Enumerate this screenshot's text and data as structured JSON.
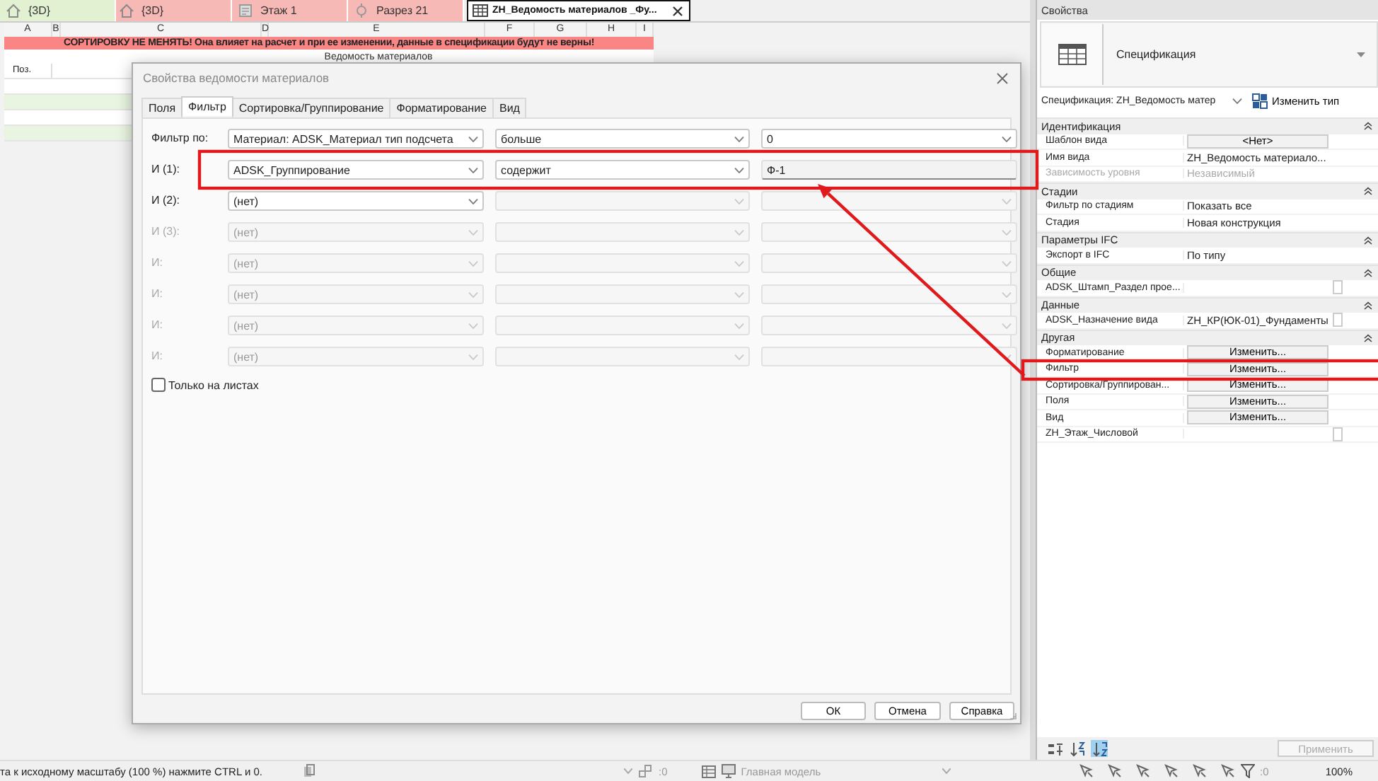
{
  "view_tabs": [
    {
      "label": "{3D}",
      "kind": "model",
      "color": "#e3f1d3",
      "selected": false
    },
    {
      "label": "{3D}",
      "kind": "model",
      "color": "#f7b9b6",
      "selected": false
    },
    {
      "label": "Этаж 1",
      "kind": "plan",
      "color": "#f7b9b6",
      "selected": false
    },
    {
      "label": "Разрез 21",
      "kind": "section",
      "color": "#f7b9b6",
      "selected": false
    },
    {
      "label": "ZH_Ведомость материалов _Фу...",
      "kind": "schedule",
      "color": "#ffffff",
      "selected": true
    }
  ],
  "schedule": {
    "columns": [
      "A",
      "B",
      "C",
      "D",
      "E",
      "F",
      "G",
      "H",
      "I"
    ],
    "banner": "СОРТИРОВКУ НЕ МЕНЯТЬ! Она влияет на расчет и при ее изменении, данные в спецификации будут не верны!",
    "title": "Ведомость материалов",
    "header_cell": "Поз."
  },
  "dialog": {
    "title": "Свойства ведомости материалов",
    "tabs": [
      {
        "label": "Поля",
        "selected": false
      },
      {
        "label": "Фильтр",
        "selected": true
      },
      {
        "label": "Сортировка/Группирование",
        "selected": false
      },
      {
        "label": "Форматирование",
        "selected": false
      },
      {
        "label": "Вид",
        "selected": false
      }
    ],
    "filter_rows": [
      {
        "label": "Фильтр по:",
        "highlighted": false,
        "disabled": false,
        "field": "Материал: ADSK_Материал тип подсчета",
        "condition": {
          "text": "больше",
          "disabled": false
        },
        "value": {
          "kind": "dropdown",
          "text": "0",
          "disabled": false
        }
      },
      {
        "label": "И (1):",
        "highlighted": true,
        "disabled": false,
        "field": "ADSK_Группирование",
        "condition": {
          "text": "содержит",
          "disabled": false
        },
        "value": {
          "kind": "text",
          "text": "Ф-1",
          "disabled": false
        }
      },
      {
        "label": "И (2):",
        "disabled": false,
        "field": "(нет)",
        "condition": {
          "disabled": true
        },
        "value": {
          "kind": "dropdown",
          "disabled": true
        }
      },
      {
        "label": "И (3):",
        "disabled": true,
        "field": "(нет)",
        "condition": {
          "disabled": true
        },
        "value": {
          "kind": "dropdown",
          "disabled": true
        }
      },
      {
        "label": "И:",
        "disabled": true,
        "field": "(нет)",
        "condition": {
          "disabled": true
        },
        "value": {
          "kind": "dropdown",
          "disabled": true
        }
      },
      {
        "label": "И:",
        "disabled": true,
        "field": "(нет)",
        "condition": {
          "disabled": true
        },
        "value": {
          "kind": "dropdown",
          "disabled": true
        }
      },
      {
        "label": "И:",
        "disabled": true,
        "field": "(нет)",
        "condition": {
          "disabled": true
        },
        "value": {
          "kind": "dropdown",
          "disabled": true
        }
      },
      {
        "label": "И:",
        "disabled": true,
        "field": "(нет)",
        "condition": {
          "disabled": true
        },
        "value": {
          "kind": "dropdown",
          "disabled": true
        }
      }
    ],
    "sheets_only": {
      "label": "Только на листах",
      "checked": false
    },
    "buttons": [
      "ОК",
      "Отмена",
      "Справка"
    ]
  },
  "properties": {
    "title": "Свойства",
    "type_name": "Спецификация",
    "instance_selector": "Спецификация: ZH_Ведомость матер",
    "edit_type": "Изменить тип",
    "groups": [
      {
        "name": "Идентификация",
        "expanded": true,
        "rows": [
          {
            "name": "Шаблон вида",
            "value": "<Нет>",
            "kind": "button",
            "disabled": false
          },
          {
            "name": "Имя вида",
            "value": "ZH_Ведомость материало...",
            "kind": "text",
            "disabled": false
          },
          {
            "name": "Зависимость уровня",
            "value": "Независимый",
            "kind": "text",
            "disabled": true
          }
        ]
      },
      {
        "name": "Стадии",
        "expanded": true,
        "rows": [
          {
            "name": "Фильтр по стадиям",
            "value": "Показать все",
            "kind": "text",
            "disabled": false
          },
          {
            "name": "Стадия",
            "value": "Новая конструкция",
            "kind": "text",
            "disabled": false
          }
        ]
      },
      {
        "name": "Параметры IFC",
        "expanded": true,
        "rows": [
          {
            "name": "Экспорт в IFC",
            "value": "По типу",
            "kind": "text",
            "disabled": false
          }
        ]
      },
      {
        "name": "Общие",
        "expanded": true,
        "rows": [
          {
            "name": "ADSK_Штамп_Раздел прое...",
            "kind": "text",
            "disabled": false,
            "checked": false
          }
        ]
      },
      {
        "name": "Данные",
        "expanded": true,
        "rows": [
          {
            "name": "ADSK_Назначение вида",
            "value": "ZH_КР(ЮК-01)_Фундаменты",
            "kind": "text",
            "disabled": false,
            "checked": false
          }
        ]
      },
      {
        "name": "Другая",
        "expanded": true,
        "rows": [
          {
            "name": "Форматирование",
            "value": "Изменить...",
            "kind": "button",
            "disabled": false
          },
          {
            "name": "Фильтр",
            "value": "Изменить...",
            "kind": "button",
            "disabled": false,
            "highlighted": true
          },
          {
            "name": "Сортировка/Группирован...",
            "value": "Изменить...",
            "kind": "button",
            "disabled": false
          },
          {
            "name": "Поля",
            "value": "Изменить...",
            "kind": "button",
            "disabled": false
          },
          {
            "name": "Вид",
            "value": "Изменить...",
            "kind": "button",
            "disabled": false
          },
          {
            "name": "ZH_Этаж_Числовой",
            "kind": "text",
            "disabled": false,
            "checked": false
          }
        ]
      }
    ],
    "sort_tools": [
      {
        "kind": "categorize",
        "selected": false
      },
      {
        "kind": "ascending",
        "selected": false
      },
      {
        "kind": "descending",
        "selected": true
      }
    ],
    "apply": {
      "label": "Применить",
      "disabled": true
    }
  },
  "status_bar": {
    "hint": "та к исходному масштабу (100 %) нажмите CTRL и 0.",
    "workset_count": ":0",
    "model": "Главная модель",
    "filter_count": ":0",
    "zoom": "100%"
  }
}
